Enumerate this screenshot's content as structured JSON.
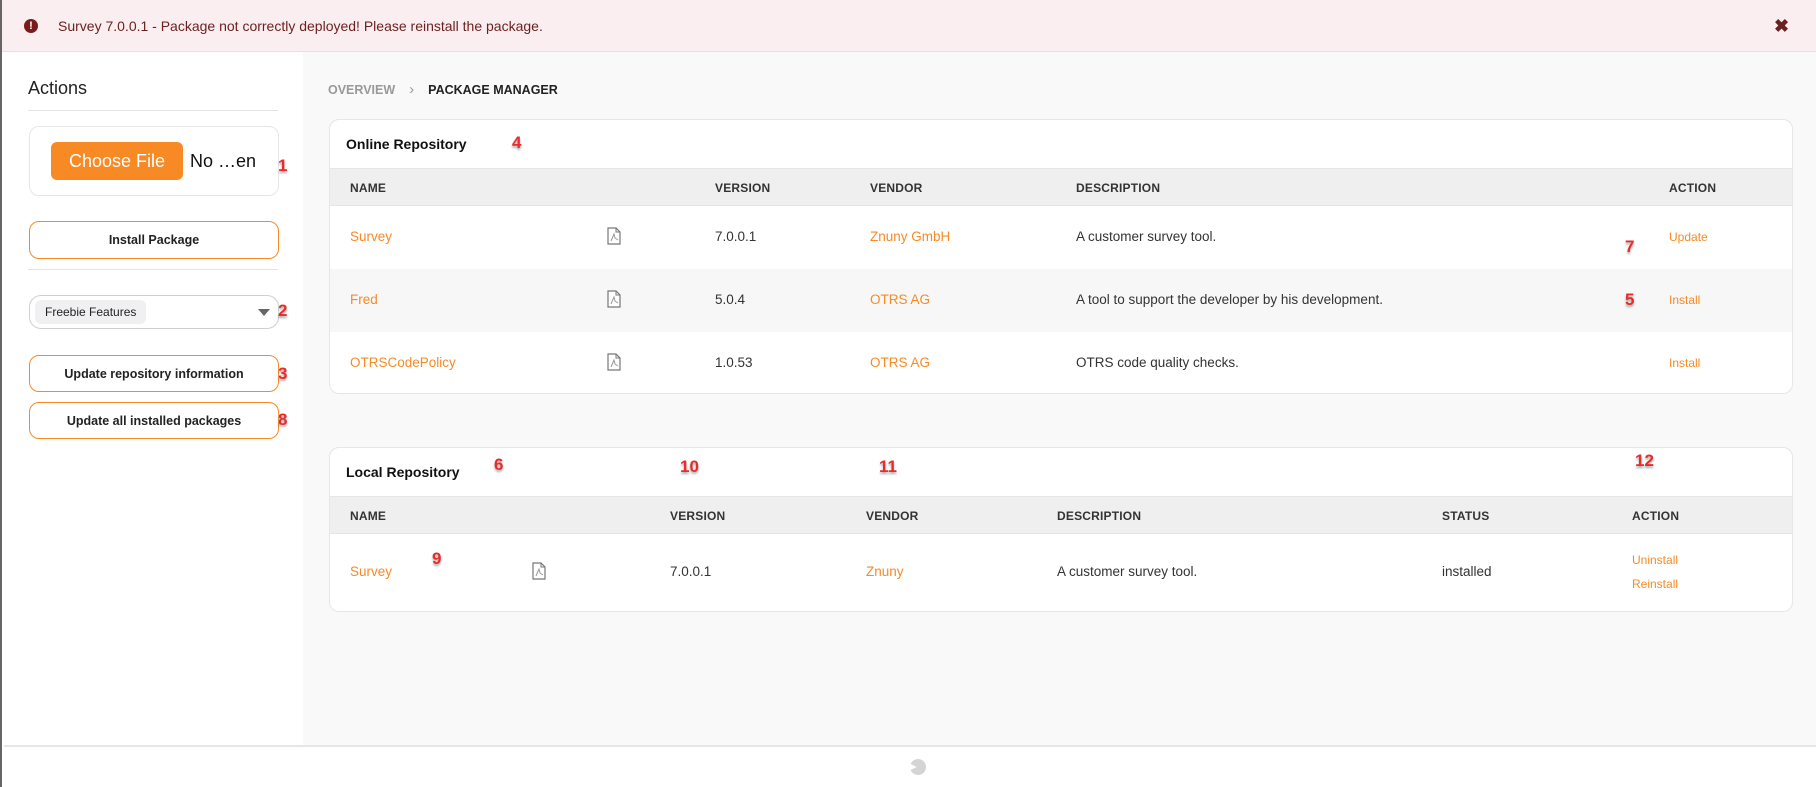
{
  "alert": {
    "icon": "exclamation-circle-icon",
    "message": "Survey 7.0.0.1 - Package not correctly deployed! Please reinstall the package.",
    "close_icon": "close-icon",
    "close_glyph": "✖"
  },
  "sidebar": {
    "title": "Actions",
    "file_input": {
      "button_label": "Choose File",
      "status": "No …en"
    },
    "install_package_label": "Install Package",
    "repository_select": {
      "selected": "Freebie Features"
    },
    "update_repository_label": "Update repository information",
    "update_all_label": "Update all installed packages"
  },
  "breadcrumb": {
    "items": [
      {
        "label": "OVERVIEW"
      },
      {
        "label": "PACKAGE MANAGER"
      }
    ],
    "separator": "›"
  },
  "online_repository": {
    "title": "Online Repository",
    "columns": [
      "NAME",
      "VERSION",
      "VENDOR",
      "DESCRIPTION",
      "ACTION"
    ],
    "rows": [
      {
        "name": "Survey",
        "version": "7.0.0.1",
        "vendor": "Znuny GmbH",
        "description": "A customer survey tool.",
        "action": "Update"
      },
      {
        "name": "Fred",
        "version": "5.0.4",
        "vendor": "OTRS AG",
        "description": "A tool to support the developer by his development.",
        "action": "Install"
      },
      {
        "name": "OTRSCodePolicy",
        "version": "1.0.53",
        "vendor": "OTRS AG",
        "description": "OTRS code quality checks.",
        "action": "Install"
      }
    ]
  },
  "local_repository": {
    "title": "Local Repository",
    "columns": [
      "NAME",
      "VERSION",
      "VENDOR",
      "DESCRIPTION",
      "STATUS",
      "ACTION"
    ],
    "rows": [
      {
        "name": "Survey",
        "version": "7.0.0.1",
        "vendor": "Znuny",
        "description": "A customer survey tool.",
        "status": "installed",
        "actions": [
          "Uninstall",
          "Reinstall"
        ]
      }
    ]
  },
  "annotations": {
    "file_input": "1",
    "repository_select": "2",
    "update_repository": "3",
    "online_title": "4",
    "fred_action": "5",
    "local_title": "6",
    "survey_action": "7",
    "update_all": "8",
    "local_name": "9",
    "local_version": "10",
    "local_vendor": "11",
    "local_action": "12"
  },
  "colors": {
    "accent": "#f78a25",
    "alert_bg": "#fbeef0",
    "alert_text": "#6b1f1f",
    "annotation": "#e82b2b"
  }
}
